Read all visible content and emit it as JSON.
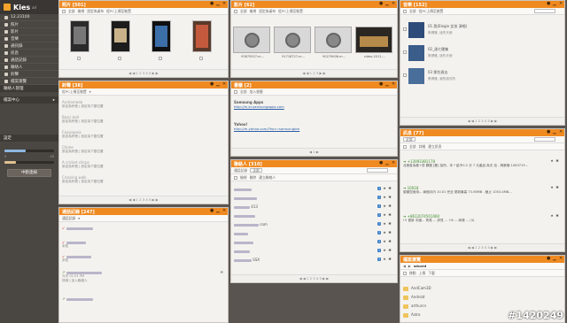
{
  "app": {
    "name": "Kies",
    "suffix": "air",
    "ip": "12.23100"
  },
  "sidebar": {
    "items": [
      "照片",
      "影片",
      "音樂",
      "通訊錄",
      "訊息",
      "通話記錄",
      "聯絡人",
      "鈴聲",
      "檔案瀏覽"
    ],
    "section1": "聯絡人管理",
    "section2": "檔案中心",
    "section3": "設定",
    "storage_label": "儲存空間",
    "storage_values": [
      "5",
      "45"
    ],
    "storage_fill": [
      0.42,
      0.24
    ],
    "button": "中斷連線"
  },
  "photos": {
    "title": "照片 [501]",
    "toolbar": [
      "全部",
      "檢視",
      "設定為桌布",
      "從PC上傳至裝置"
    ],
    "pager": "◀ ◀ 1 2 3 4 5 ▶ ▶"
  },
  "videos": {
    "title": "影片 [62]",
    "toolbar": [
      "全部",
      "檢視",
      "設定為桌布",
      "從PC上傳至裝置"
    ],
    "items": [
      "93875557.m...",
      "91718727.m...",
      "90279008.m...",
      "video-2011-..."
    ],
    "pager": "◀ ◀ 1 2 3 ▶ ▶"
  },
  "music": {
    "title": "音樂 [152]",
    "toolbar": [
      "全部",
      "從PC上傳至裝置"
    ],
    "items": [
      {
        "title": "01.我(Elegie 女孩 演唱)",
        "sub": "蔡健雅, 迷失天使"
      },
      {
        "title": "02_達七匯集",
        "sub": "蔡健雅, 迷失天使"
      },
      {
        "title": "03 那些過去",
        "sub": "蔡健雅, 我的過去的"
      }
    ],
    "pager": "◀ ◀ 1 2 3 4 5 ▶ ▶"
  },
  "ringtones": {
    "title": "鈴聲 [38]",
    "toolbar": [
      "從PC上傳至裝置"
    ],
    "items": [
      {
        "name": "Andromeda",
        "sub": "設定為鈴聲 | 設定為下載位置"
      },
      {
        "name": "Basic bell",
        "sub": "設定為鈴聲 | 設定為下載位置"
      },
      {
        "name": "Cassiopeia",
        "sub": "設定為鈴聲 | 設定為下載位置"
      },
      {
        "name": "Chime",
        "sub": "設定為鈴聲 | 設定為下載位置"
      },
      {
        "name": "A cricket chirps",
        "sub": "設定為鈴聲 | 設定為下載位置"
      },
      {
        "name": "Crossing walk",
        "sub": "設定為鈴聲 | 設定為下載位置"
      }
    ],
    "pager": "◀ ◀ 1 2 3 4 5 ▶ ▶"
  },
  "bookmarks": {
    "title": "書籤 [2]",
    "toolbar": [
      "全部",
      "加入書籤"
    ],
    "items": [
      {
        "name": "Samsung Apps",
        "url": "http://m.kr.samsungapps.com"
      },
      {
        "name": "Yahoo!",
        "url": "http://m.yahoo.com/?tsrc=samsungbm"
      }
    ],
    "pager": "◀ 1 ▶"
  },
  "calls": {
    "title": "通話記錄 [247]",
    "filter": "通話記錄",
    "pager": "◀ ◀ 1 2 3 4 5 ▶ ▶",
    "items": [
      {
        "sub": "",
        "time": ""
      },
      {
        "sub": "未知",
        "time": ""
      },
      {
        "sub": "未知",
        "time": ""
      },
      {
        "sub": "",
        "time": "今天 01:01 PM"
      },
      {
        "sub": "",
        "time": ""
      }
    ],
    "action": "詳細 | 加入聯絡人"
  },
  "contacts": {
    "title": "聯絡人 [310]",
    "filter": "全部",
    "toolbar": [
      "檢視",
      "刪除",
      "建立聯絡人"
    ],
    "rows": [
      "",
      "",
      "413",
      "",
      "com",
      "",
      "",
      "",
      "SSX"
    ],
    "pager": "◀ ◀ 1 2 3 4 5 ▶ ▶"
  },
  "messages": {
    "title": "訊息 [77]",
    "filter": "全部",
    "toolbar": [
      "全部",
      "詳細",
      "建立訊息"
    ],
    "items": [
      {
        "num": "+13093381178",
        "text": "北美各為都+贊 夥團 [郵] 拾所，本 * 給予0.2 分 7 元產品.為天 站 - 夠數晚 1063719..."
      },
      {
        "num": "10018",
        "text": "謝謝您使用... 兩個月內 10.01 完全 更新最高 73.56MB - 截止 1053.4MB..."
      },
      {
        "num": "+8612074501060",
        "text": "!!! 更新 中國... 會員 ... 詳見 ... +8 ... 商場 ... (3)"
      }
    ],
    "pager": "◀ ◀ 1 2 3 4 5 ▶ ▶"
  },
  "files": {
    "title": "檔案瀏覽",
    "path": "sdcard",
    "toolbar": [
      "移動",
      "上傳",
      "下載"
    ],
    "items": [
      "AndCam3D",
      "Android",
      "arthurcn",
      "Astro"
    ]
  },
  "watermark": "#1420249",
  "colors": {
    "accent": "#ef8a21",
    "sidebar": "#4a4642",
    "panel": "#f4f2ee"
  }
}
